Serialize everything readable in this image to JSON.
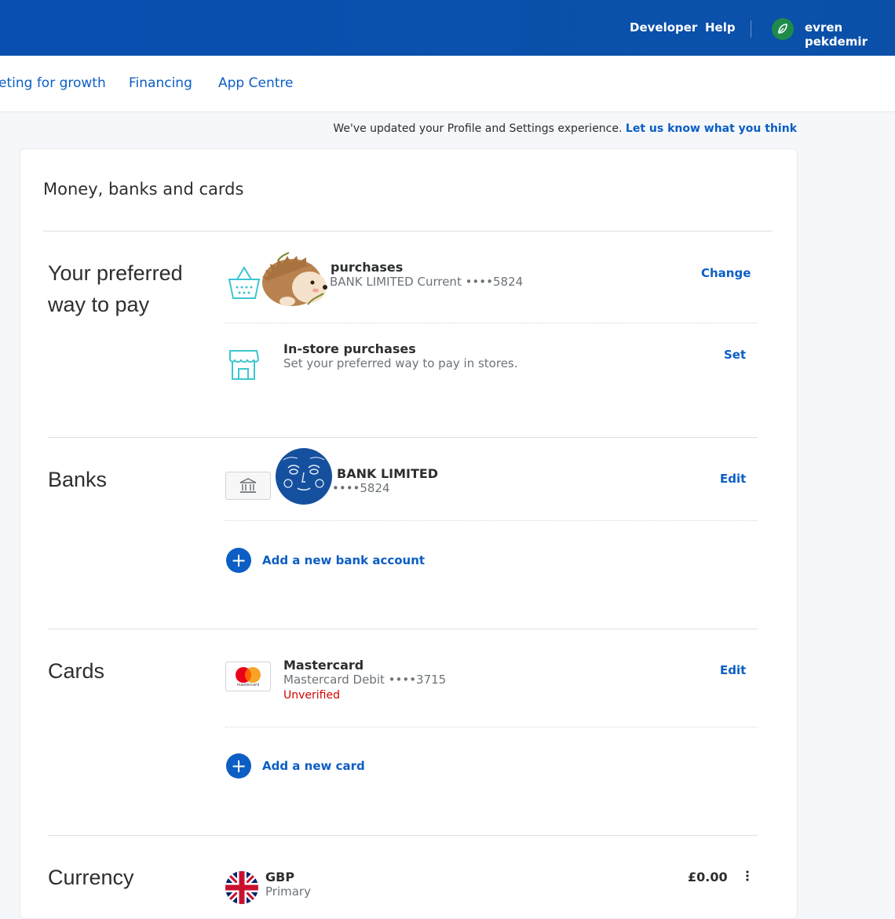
{
  "header": {
    "links": [
      {
        "label": "Developer"
      },
      {
        "label": "Help"
      }
    ],
    "user_name": "evren pekdemir"
  },
  "subnav": {
    "items": [
      {
        "label": "eting for growth"
      },
      {
        "label": "Financing"
      },
      {
        "label": "App Centre"
      }
    ]
  },
  "notice": {
    "text": "We've updated your Profile and Settings experience.",
    "link": "Let us know what you think"
  },
  "page_title": "Money, banks and cards",
  "preferred": {
    "title_line1": "Your preferred",
    "title_line2": "way to pay",
    "online": {
      "title": "purchases",
      "subtitle": "BANK LIMITED Current ••••5824",
      "action": "Change"
    },
    "instore": {
      "title": "In-store purchases",
      "subtitle": "Set your preferred way to pay in stores.",
      "action": "Set"
    }
  },
  "banks": {
    "title": "Banks",
    "item": {
      "name": "BANK LIMITED",
      "number": "••••5824",
      "action": "Edit"
    },
    "add_label": "Add a new bank account"
  },
  "cards": {
    "title": "Cards",
    "item": {
      "name": "Mastercard",
      "detail": "Mastercard Debit ••••3715",
      "status": "Unverified",
      "action": "Edit",
      "logo_text": "mastercard"
    },
    "add_label": "Add a new card"
  },
  "currency": {
    "title": "Currency",
    "code": "GBP",
    "label": "Primary",
    "balance": "£0.00"
  },
  "colors": {
    "brand_blue": "#0c5ec4",
    "header_blue": "#0a4fb0",
    "error_red": "#d20000",
    "icon_teal": "#3cc6d0"
  }
}
